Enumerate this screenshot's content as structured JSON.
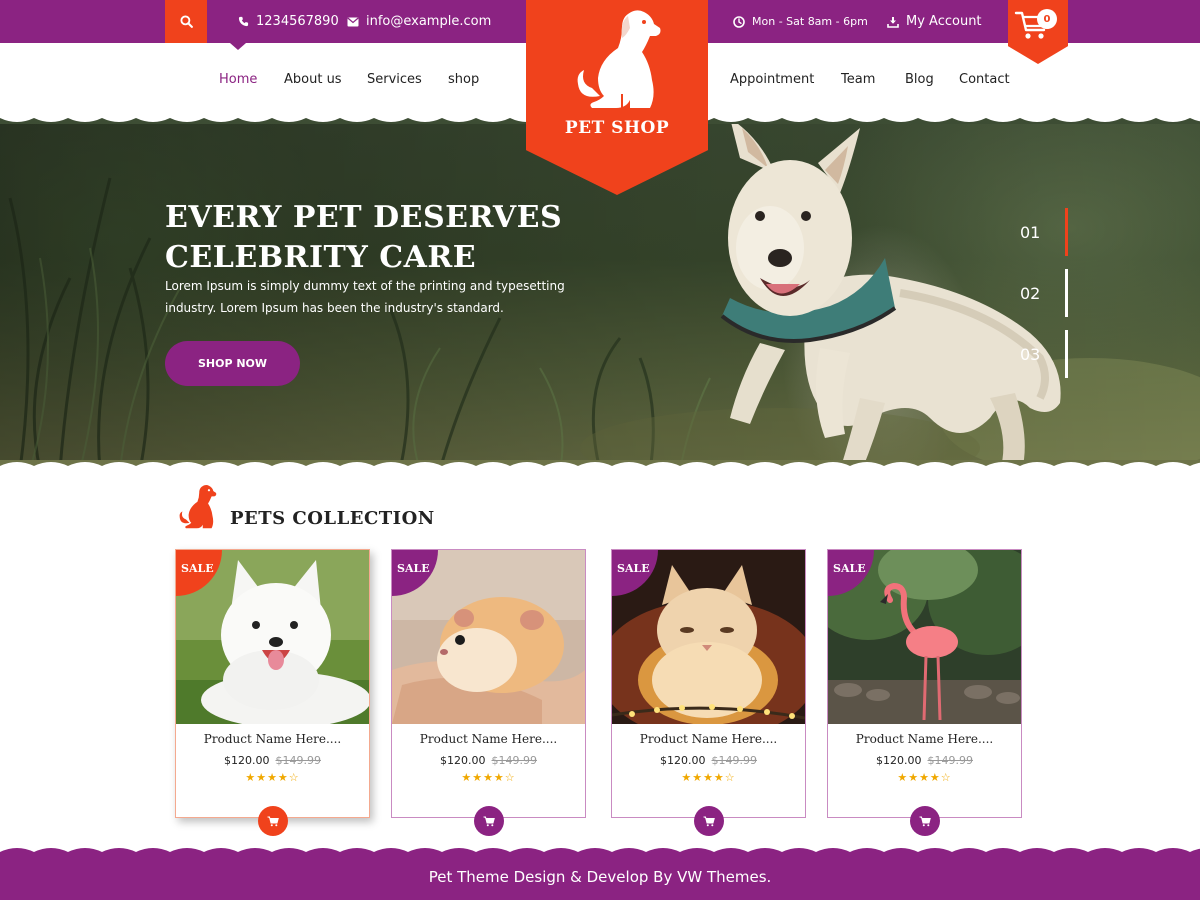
{
  "topbar": {
    "phone": "1234567890",
    "email": "info@example.com",
    "hours": "Mon - Sat 8am - 6pm",
    "account": "My Account",
    "cart_count": "0"
  },
  "nav": {
    "left": [
      "Home",
      "About us",
      "Services",
      "shop"
    ],
    "right": [
      "Appointment",
      "Team",
      "Blog",
      "Contact"
    ],
    "active": "Home"
  },
  "logo": {
    "text": "PET SHOP"
  },
  "hero": {
    "title_line1": "EVERY PET DESERVES",
    "title_line2": "CELEBRITY CARE",
    "text": "Lorem Ipsum is simply dummy text of the printing and typesetting industry. Lorem Ipsum has been the industry's standard.",
    "button": "SHOP NOW",
    "slides": [
      "01",
      "02",
      "03"
    ],
    "active_slide": "01"
  },
  "collection": {
    "title": "PETS COLLECTION",
    "products": [
      {
        "badge": "SALE",
        "name": "Product Name Here....",
        "price": "$120.00",
        "old_price": "$149.99",
        "stars": "★★★★☆",
        "rating": 4,
        "image": "white-dog"
      },
      {
        "badge": "SALE",
        "name": "Product Name Here....",
        "price": "$120.00",
        "old_price": "$149.99",
        "stars": "★★★★☆",
        "rating": 4,
        "image": "hamster"
      },
      {
        "badge": "SALE",
        "name": "Product Name Here....",
        "price": "$120.00",
        "old_price": "$149.99",
        "stars": "★★★★☆",
        "rating": 4,
        "image": "kitten"
      },
      {
        "badge": "SALE",
        "name": "Product Name Here....",
        "price": "$120.00",
        "old_price": "$149.99",
        "stars": "★★★★☆",
        "rating": 4,
        "image": "flamingo"
      }
    ]
  },
  "footer": {
    "text": "Pet Theme Design & Develop By VW Themes."
  },
  "colors": {
    "purple": "#8b2382",
    "orange": "#f0421c"
  },
  "icons": [
    "search-icon",
    "phone-icon",
    "email-icon",
    "clock-icon",
    "download-icon",
    "cart-icon",
    "dog-logo-icon"
  ]
}
